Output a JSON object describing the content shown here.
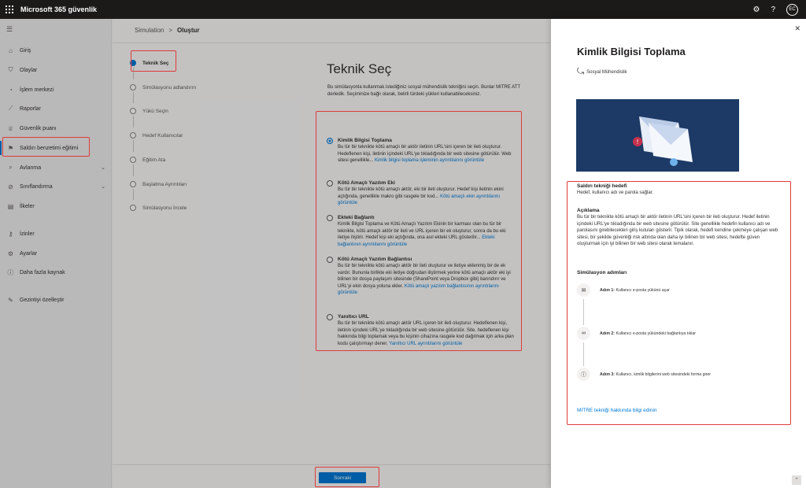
{
  "topbar": {
    "app_title": "Microsoft 365 güvenlik",
    "avatar_initials": "EC"
  },
  "leftnav": {
    "items": [
      {
        "label": "Giriş",
        "icon": "home-icon",
        "glyph": "⌂"
      },
      {
        "label": "Olaylar",
        "icon": "shield-icon",
        "glyph": "⛉"
      },
      {
        "label": "İşlem merkezi",
        "icon": "action-center-icon",
        "glyph": "◔"
      },
      {
        "label": "Raporlar",
        "icon": "chart-icon",
        "glyph": "⟋"
      },
      {
        "label": "Güvenlik puanı",
        "icon": "trophy-icon",
        "glyph": "♕"
      },
      {
        "label": "Saldırı benzetimi eğitimi",
        "icon": "target-icon",
        "glyph": "⚑"
      },
      {
        "label": "Avlanma",
        "icon": "hunting-icon",
        "glyph": "⌕"
      },
      {
        "label": "Sınıflandırma",
        "icon": "classification-icon",
        "glyph": "⊘"
      },
      {
        "label": "İlkeler",
        "icon": "policy-icon",
        "glyph": "▤"
      },
      {
        "label": "İzinler",
        "icon": "key-icon",
        "glyph": "⚷"
      },
      {
        "label": "Ayarlar",
        "icon": "gear-icon",
        "glyph": "⚙"
      },
      {
        "label": "Daha fazla kaynak",
        "icon": "info-icon",
        "glyph": "ⓘ"
      },
      {
        "label": "Gezintiyi özelleştir",
        "icon": "edit-icon",
        "glyph": "✎"
      }
    ]
  },
  "breadcrumb": {
    "parent": "Simulation",
    "separator": ">",
    "current": "Oluştur"
  },
  "steps": [
    "Teknik Seç",
    "Simülasyonu adlandırın",
    "Yükü Seçin",
    "Hedef Kullanıcılar",
    "Eğitim Ata",
    "Başlatma Ayrıntıları",
    "Simülasyonu İncele"
  ],
  "main": {
    "heading": "Teknik Seç",
    "intro_line1": "Bu simülasyonla kullanmak istediğiniz sosyal mühendislik tekniğini seçin. Bunlar MITRE ATT",
    "intro_line2": "derledik. Seçiminize bağlı olarak, belirli türdeki yükleri kullanabileceksiniz.",
    "next_button": "Sonraki"
  },
  "options": [
    {
      "title": "Kimlik Bilgisi Toplama",
      "desc": "Bu tür bir teknikte kötü amaçlı bir aktör iletinin URL'sini içeren bir ileti oluşturur. Hedeflenen kişi, iletinin içindeki URL'ye tıkladığında bir web sitesine götürülür. Web sitesi genellikle...",
      "link": "Kimlik bilgisi toplama işleminin ayrıntılarını görüntüle",
      "selected": true
    },
    {
      "title": "Kötü Amaçlı Yazılım Eki",
      "desc": "Bu tür bir teknikte kötü amaçlı aktör, eki bir ileti oluşturur. Hedef kişi iletinin ekini açtığında, genellikle makro gibi rasgele bir kod...",
      "link": "Kötü amaçlı ekin ayrıntılarını görüntüle",
      "selected": false
    },
    {
      "title": "Ekteki Bağlantı",
      "desc": "Kimlik Bilgisi Toplama ve Kötü Amaçlı Yazılım Ekinin bir karması olan bu tür bir teknikte, kötü amaçlı aktör bir ileti ve URL içeren bir ek oluşturur, sonra da bu eki iletiye iliştirir. Hedef kişi eki açtığında, ona asıl ekteki URL gösterilir...",
      "link": "Ekteki bağlantının ayrıntılarını görüntüle",
      "selected": false
    },
    {
      "title": "Kötü Amaçlı Yazılım Bağlantısı",
      "desc": "Bu tür bir teknikte kötü amaçlı aktör bir ileti oluşturur ve iletiye eklenmiş bir de ek vardır. Bununla birlikte eki iletiye doğrudan iliştirmek yerine kötü amaçlı aktör eki iyi bilinen bir dosya paylaşım sitesinde (SharePoint veya Dropbox gibi) barındırır ve URL'yi ekin dosya yoluna ekler.",
      "link": "Kötü amaçlı yazılım bağlantısının ayrıntılarını görüntüle",
      "selected": false
    },
    {
      "title": "Yanıltıcı URL",
      "desc": "Bu tür bir teknikte kötü amaçlı aktör URL içeren bir ileti oluşturur. Hedeflenen kişi, iletinin içindeki URL'ye tıkladığında bir web sitesine götürülür. Site, hedeflenen kişi hakkında bilgi toplamak veya bu kişinin cihazına rasgele kod dağıtmak için arka plan kodu çalıştırmayı dener.",
      "link": "Yanıltıcı URL ayrıntılarını görüntüle",
      "selected": false
    }
  ],
  "panel": {
    "title": "Kimlik Bilgisi Toplama",
    "subtitle": "Sosyal Mühendislik",
    "goal_heading": "Saldırı tekniği hedefi",
    "goal_text": "Hedef, kullanıcı adı ve parola sağlar.",
    "desc_heading": "Açıklama",
    "desc_text": "Bu tür bir teknikte kötü amaçlı bir aktör iletinin URL'sini içeren bir ileti oluşturur. Hedef iletinin içindeki URL'ye tıkladığında bir web sitesine götürülür. Site genellikle hedefin kullanıcı adı ve parolasını girebilecekleri giriş kutuları gösterir. Tipik olarak, hedefi kendine çekmeye çalışan web sitesi, bir şekilde güvenliği risk altında olan daha iyi bilinen bir web sitesi, hedefte güven oluşturmak için iyi bilinen bir web sitesi olarak temalanır.",
    "steps_heading": "Simülasyon adımları",
    "sim_steps": [
      {
        "label": "Adım 1:",
        "text": "Kullanıcı e-posta yükünü açar",
        "icon": "mail-icon"
      },
      {
        "label": "Adım 2:",
        "text": "Kullanıcı e-posta yükündeki bağlantıya tıklar",
        "icon": "link-icon"
      },
      {
        "label": "Adım 3:",
        "text": "Kullanıcı, kimlik bilgilerini web sitesindeki forma girer",
        "icon": "info-icon"
      }
    ],
    "mitre_link": "MITRE tekniği hakkında bilgi edinin"
  }
}
